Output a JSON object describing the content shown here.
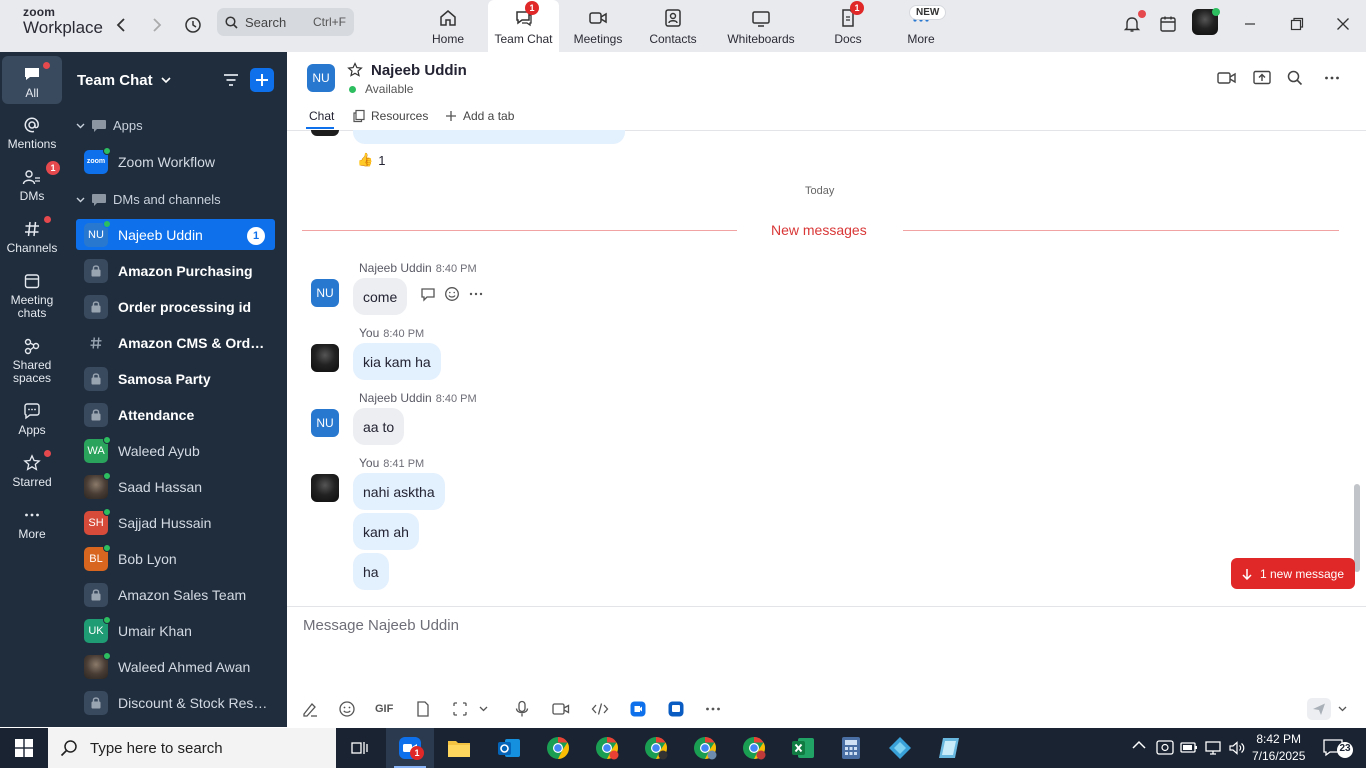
{
  "app": {
    "logo_line1": "zoom",
    "logo_line2": "Workplace",
    "search_label": "Search",
    "search_shortcut": "Ctrl+F"
  },
  "top_tabs": [
    {
      "label": "Home",
      "icon": "home-icon"
    },
    {
      "label": "Team Chat",
      "icon": "chat-icon",
      "badge": "1",
      "active": true
    },
    {
      "label": "Meetings",
      "icon": "video-icon"
    },
    {
      "label": "Contacts",
      "icon": "contacts-icon"
    },
    {
      "label": "Whiteboards",
      "icon": "whiteboard-icon"
    },
    {
      "label": "Docs",
      "icon": "docs-icon",
      "badge": "1"
    },
    {
      "label": "More",
      "icon": "more-icon",
      "new_badge": "NEW"
    }
  ],
  "rail": [
    {
      "label": "All",
      "icon": "chat-bubble-icon",
      "active": true,
      "dot": true
    },
    {
      "label": "Mentions",
      "icon": "at-icon"
    },
    {
      "label": "DMs",
      "icon": "people-icon",
      "badge": "1"
    },
    {
      "label": "Channels",
      "icon": "hash-icon",
      "dot": true
    },
    {
      "label": "Meeting chats",
      "icon": "calendar-icon"
    },
    {
      "label": "Shared spaces",
      "icon": "share-icon"
    },
    {
      "label": "Apps",
      "icon": "apps-icon"
    },
    {
      "label": "Starred",
      "icon": "star-icon",
      "dot": true
    },
    {
      "label": "More",
      "icon": "more-dots-icon"
    }
  ],
  "panel": {
    "title": "Team Chat",
    "section_apps": "Apps",
    "section_dms": "DMs and channels",
    "app_items": [
      {
        "name": "Zoom Workflow",
        "avatar": "zoom",
        "color": "#0e71eb"
      }
    ],
    "items": [
      {
        "name": "Najeeb Uddin",
        "type": "person",
        "initials": "NU",
        "color": "#2878d0",
        "online": true,
        "active": true,
        "count": "1"
      },
      {
        "name": "Amazon Purchasing",
        "type": "lock",
        "bold": true
      },
      {
        "name": "Order processing id",
        "type": "lock",
        "bold": true
      },
      {
        "name": "Amazon CMS & Order...",
        "type": "hash",
        "bold": true
      },
      {
        "name": "Samosa Party",
        "type": "lock",
        "bold": true
      },
      {
        "name": "Attendance",
        "type": "lock",
        "bold": true
      },
      {
        "name": "Waleed Ayub",
        "type": "person",
        "initials": "WA",
        "color": "#2aa35c",
        "online": true
      },
      {
        "name": "Saad Hassan",
        "type": "photo",
        "online": true
      },
      {
        "name": "Sajjad Hussain",
        "type": "person",
        "initials": "SH",
        "color": "#d64b3a",
        "online": true
      },
      {
        "name": "Bob Lyon",
        "type": "person",
        "initials": "BL",
        "color": "#d9661e",
        "online": true
      },
      {
        "name": "Amazon Sales Team",
        "type": "lock"
      },
      {
        "name": "Umair Khan",
        "type": "person",
        "initials": "UK",
        "color": "#1f9c74",
        "online": true
      },
      {
        "name": "Waleed Ahmed Awan",
        "type": "photo",
        "online": true
      },
      {
        "name": "Discount & Stock Reser...",
        "type": "lock"
      }
    ]
  },
  "chat": {
    "contact_initials": "NU",
    "contact_name": "Najeeb Uddin",
    "status": "Available",
    "tabs": [
      "Chat",
      "Resources",
      "Add a tab"
    ],
    "reaction_emoji": "👍",
    "reaction_count": "1",
    "day_separator": "Today",
    "new_messages_label": "New messages",
    "messages": [
      {
        "sender": "Najeeb Uddin",
        "time": "8:40 PM",
        "initials": "NU",
        "mine": false,
        "bubbles": [
          "come"
        ]
      },
      {
        "sender": "You",
        "time": "8:40 PM",
        "mine": true,
        "bubbles": [
          "kia kam ha"
        ]
      },
      {
        "sender": "Najeeb Uddin",
        "time": "8:40 PM",
        "initials": "NU",
        "mine": false,
        "bubbles": [
          "aa to"
        ]
      },
      {
        "sender": "You",
        "time": "8:41 PM",
        "mine": true,
        "bubbles": [
          "nahi asktha",
          "kam ah",
          "ha"
        ]
      }
    ],
    "new_message_pill": "1 new message",
    "compose_placeholder": "Message Najeeb Uddin",
    "gif_label": "GIF"
  },
  "taskbar": {
    "search_placeholder": "Type here to search",
    "time": "8:42 PM",
    "date": "7/16/2025",
    "notification_count": "23",
    "zoom_badge": "1"
  }
}
